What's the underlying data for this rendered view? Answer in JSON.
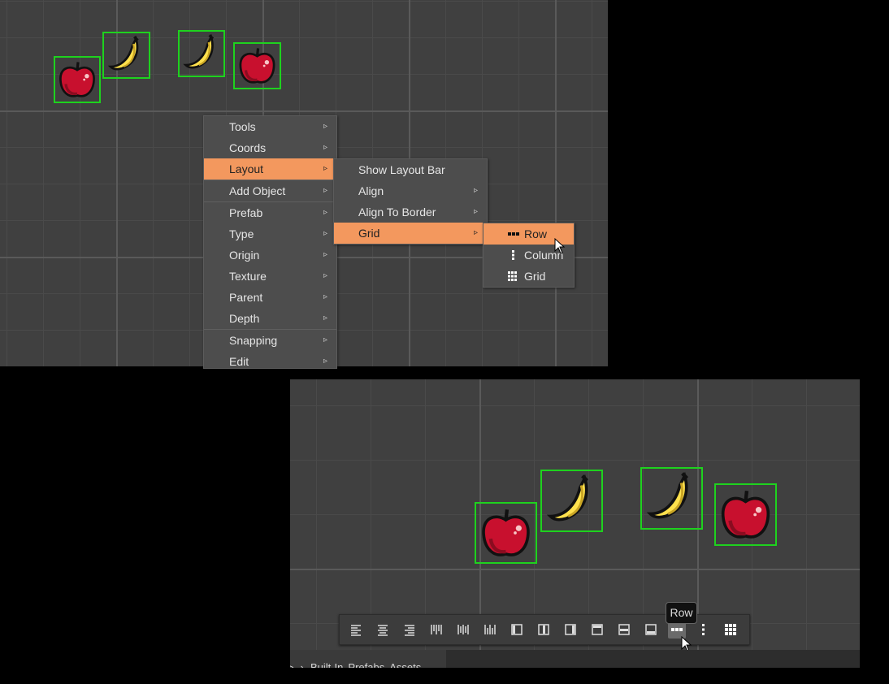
{
  "context_menu": {
    "items": [
      {
        "label": "Tools"
      },
      {
        "label": "Coords"
      },
      {
        "label": "Layout"
      },
      {
        "label": "Add Object"
      },
      {
        "label": "Prefab"
      },
      {
        "label": "Type"
      },
      {
        "label": "Origin"
      },
      {
        "label": "Texture"
      },
      {
        "label": "Parent"
      },
      {
        "label": "Depth"
      },
      {
        "label": "Snapping"
      },
      {
        "label": "Edit"
      }
    ],
    "arrow_glyph": "▹",
    "active_item": "Layout"
  },
  "layout_submenu": {
    "items": [
      {
        "label": "Show Layout Bar"
      },
      {
        "label": "Align"
      },
      {
        "label": "Align To Border"
      },
      {
        "label": "Grid"
      }
    ],
    "active_item": "Grid"
  },
  "grid_submenu": {
    "items": [
      {
        "label": "Row",
        "icon": "row-dots-icon"
      },
      {
        "label": "Column",
        "icon": "column-dots-icon"
      },
      {
        "label": "Grid",
        "icon": "grid-dots-icon"
      }
    ],
    "active_item": "Row"
  },
  "scene_top": {
    "sprites": [
      "apple",
      "banana",
      "banana",
      "apple"
    ]
  },
  "scene_bottom": {
    "sprites": [
      "apple",
      "banana",
      "banana",
      "apple"
    ]
  },
  "layout_bar": {
    "buttons": [
      "align-left-icon",
      "align-center-icon",
      "align-right-icon",
      "align-top-icon",
      "align-middle-icon",
      "align-bottom-icon",
      "align-border-left-icon",
      "align-border-center-icon",
      "align-border-right-icon",
      "align-border-top-icon",
      "align-border-middle-icon",
      "align-border-bottom-icon",
      "grid-row-icon",
      "grid-column-icon",
      "grid-grid-icon"
    ],
    "active_button": "grid-row-icon",
    "tooltip": "Row"
  },
  "bottom_bar": {
    "breadcrumb": [
      ">",
      "›",
      "Built-In",
      "Prefabs",
      "Assets"
    ]
  },
  "colors": {
    "menu_highlight": "#f3985e",
    "selection_outline": "#1ed21e",
    "canvas_bg": "#404040"
  }
}
